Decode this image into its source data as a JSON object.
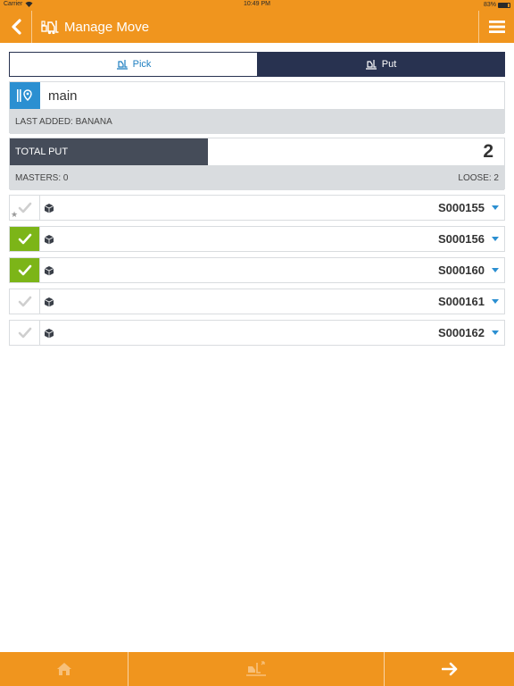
{
  "status_bar": {
    "carrier": "Carrier",
    "time": "10:49 PM",
    "battery": "83%",
    "battery_level": 0.83
  },
  "header": {
    "title": "Manage Move",
    "back_icon": "chevron-left-icon",
    "menu_icon": "hamburger-menu-icon"
  },
  "segments": {
    "pick_label": "Pick",
    "put_label": "Put",
    "selected": "Put"
  },
  "location": {
    "name": "main",
    "last_added": "LAST ADDED: BANANA"
  },
  "totals": {
    "label": "TOTAL PUT",
    "count": "2",
    "masters": "MASTERS: 0",
    "loose": "LOOSE: 2",
    "bar_fraction": 0.4
  },
  "items": [
    {
      "sku": "S000155",
      "checked": false,
      "starred": true
    },
    {
      "sku": "S000156",
      "checked": true,
      "starred": false
    },
    {
      "sku": "S000160",
      "checked": true,
      "starred": false
    },
    {
      "sku": "S000161",
      "checked": false,
      "starred": false
    },
    {
      "sku": "S000162",
      "checked": false,
      "starred": false
    }
  ],
  "colors": {
    "accent": "#f0951e",
    "navy": "#283250",
    "blue": "#2b8fd1",
    "green": "#7cb518",
    "gray": "#d9dcdf",
    "dark_bar": "#454c59"
  }
}
